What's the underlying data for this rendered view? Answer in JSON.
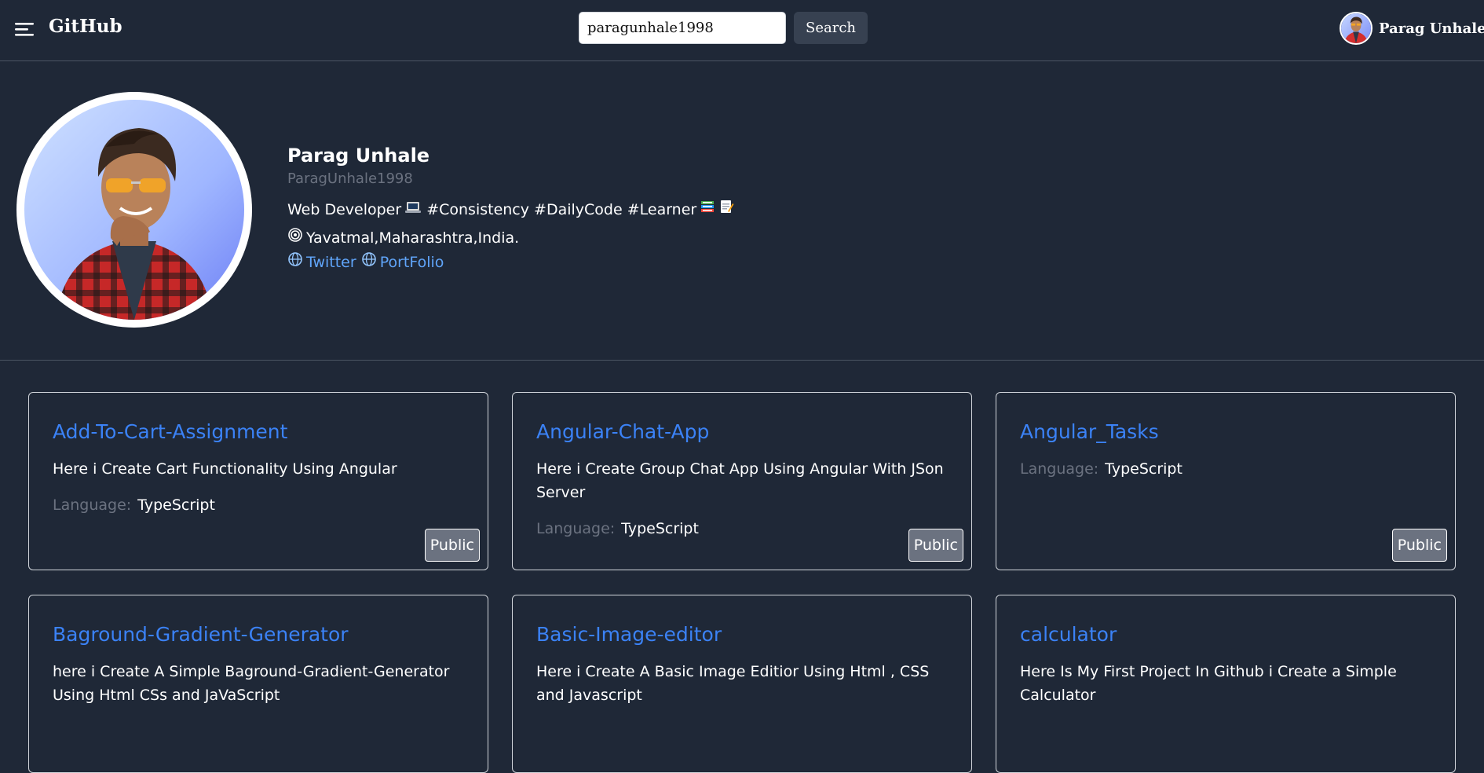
{
  "header": {
    "brand": "GitHub",
    "search_value": "paragunhale1998",
    "search_button": "Search",
    "user_name": "Parag Unhale"
  },
  "profile": {
    "name": "Parag Unhale",
    "login": "ParagUnhale1998",
    "bio": "Web Developer",
    "bio_tags": "#Consistency #DailyCode #Learner",
    "location": "Yavatmal,Maharashtra,India.",
    "links": [
      {
        "label": "Twitter"
      },
      {
        "label": "PortFolio"
      }
    ]
  },
  "repos": {
    "language_label": "Language:",
    "items": [
      {
        "name": "Add-To-Cart-Assignment",
        "description": "Here i Create Cart Functionality Using Angular",
        "language": "TypeScript",
        "visibility": "Public"
      },
      {
        "name": "Angular-Chat-App",
        "description": "Here i Create Group Chat App Using Angular With JSon Server",
        "language": "TypeScript",
        "visibility": "Public"
      },
      {
        "name": "Angular_Tasks",
        "description": "",
        "language": "TypeScript",
        "visibility": "Public"
      },
      {
        "name": "Baground-Gradient-Generator",
        "description": "here i Create A Simple Baground-Gradient-Generator Using Html CSs and JaVaScript",
        "language": "",
        "visibility": ""
      },
      {
        "name": "Basic-Image-editor",
        "description": "Here i Create A Basic Image Editior Using Html , CSS and Javascript",
        "language": "",
        "visibility": ""
      },
      {
        "name": "calculator",
        "description": "Here Is My First Project In Github i Create a Simple Calculator",
        "language": "",
        "visibility": ""
      }
    ]
  },
  "colors": {
    "background": "#1f2837",
    "link": "#3b82f6",
    "link_light": "#60a5fa",
    "muted": "#6b7280",
    "badge": "#6b7280"
  },
  "icons": {
    "menu": "hamburger-menu-icon",
    "laptop": "laptop-icon",
    "books": "books-icon",
    "memo": "memo-icon",
    "location": "location-spiral-icon",
    "globe": "globe-icon"
  }
}
